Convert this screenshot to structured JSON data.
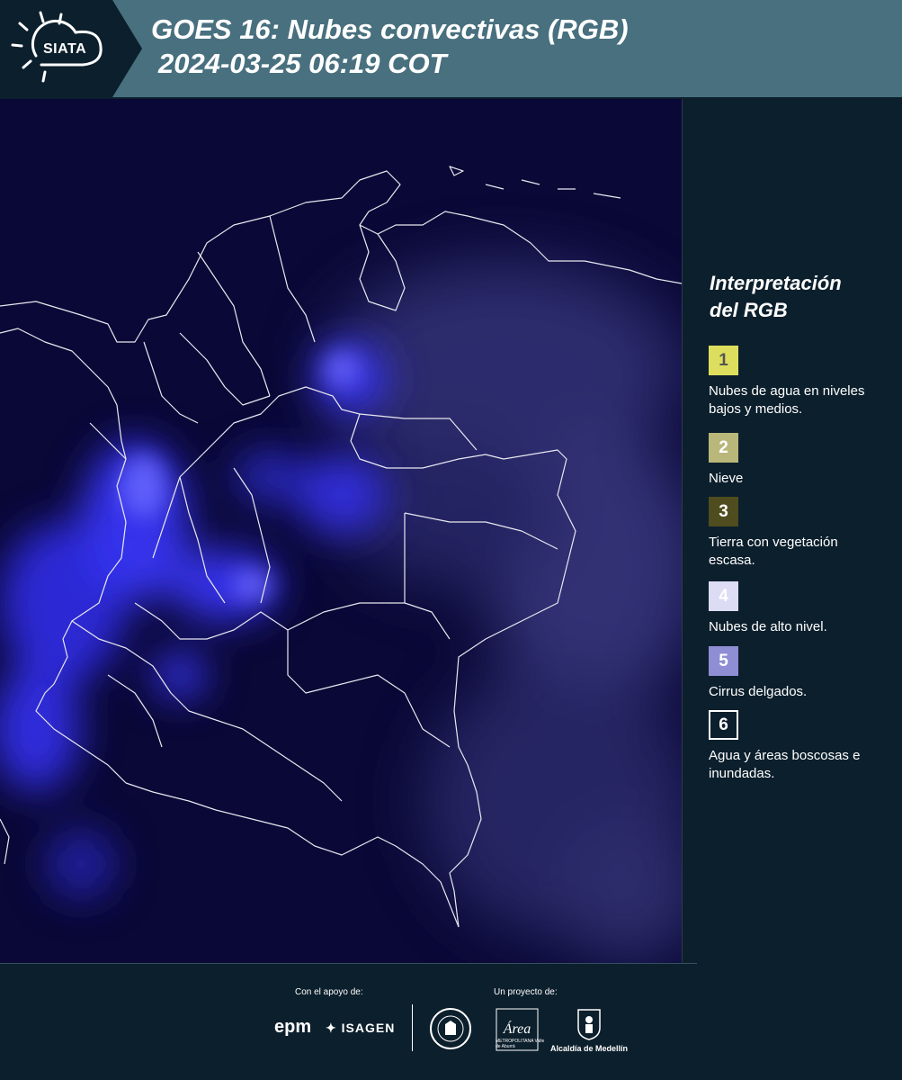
{
  "header": {
    "logo_text": "SIATA",
    "title_line1": "GOES 16: Nubes convectivas (RGB)",
    "title_line2": "2024-03-25 06:19 COT"
  },
  "legend": {
    "title_line1": "Interpretación",
    "title_line2": "del RGB",
    "items": [
      {
        "number": "1",
        "label": "Nubes de agua en niveles bajos y medios.",
        "color": "#dede5e",
        "text_color": "#555555"
      },
      {
        "number": "2",
        "label": "Nieve",
        "color": "#b9b77a",
        "text_color": "#ffffff"
      },
      {
        "number": "3",
        "label": "Tierra con vegetación escasa.",
        "color": "#4f4d1f",
        "text_color": "#ffffff"
      },
      {
        "number": "4",
        "label": "Nubes de alto nivel.",
        "color": "#dcdcf4",
        "text_color": "#ffffff"
      },
      {
        "number": "5",
        "label": "Cirrus delgados.",
        "color": "#8f8dd4",
        "text_color": "#ffffff"
      },
      {
        "number": "6",
        "label": "Agua y áreas boscosas e inundadas.",
        "color": "#0c1f2c",
        "text_color": "#ffffff"
      }
    ]
  },
  "footer": {
    "support_label": "Con el apoyo de:",
    "project_label": "Un proyecto de:",
    "epm": "epm",
    "isagen": "ISAGEN",
    "area_sub": "METROPOLITANA Valle de Aburrá",
    "area_main": "Área",
    "alcaldia": "Alcaldía de Medellín"
  },
  "colors": {
    "header_bg": "#48707f",
    "panel_bg": "#0c1f2c",
    "map_bg": "#0a0836",
    "convective_cloud": "#3a36ff"
  }
}
